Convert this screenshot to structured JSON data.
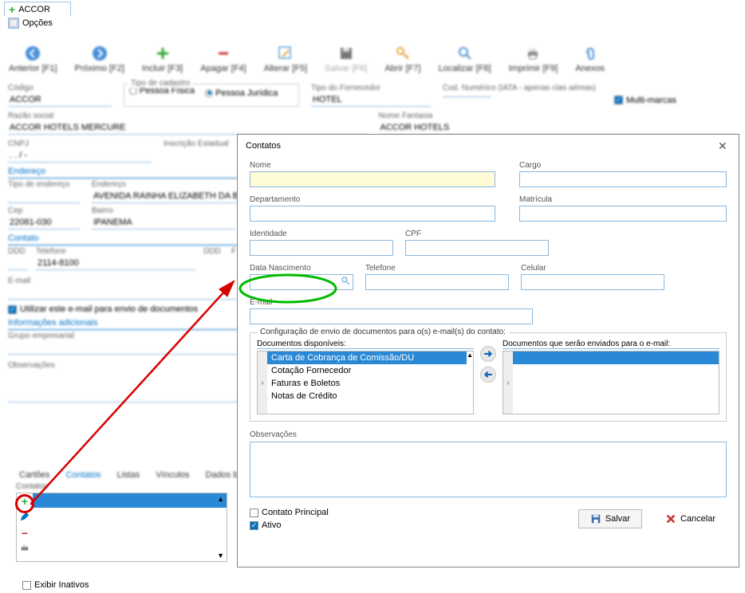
{
  "windowTab": "ACCOR",
  "optionsMenu": "Opções",
  "toolbar": [
    {
      "id": "anterior",
      "label": "Anterior [F1]"
    },
    {
      "id": "proximo",
      "label": "Próximo [F2]"
    },
    {
      "id": "incluir",
      "label": "Incluir [F3]"
    },
    {
      "id": "apagar",
      "label": "Apagar [F4]"
    },
    {
      "id": "alterar",
      "label": "Alterar [F5]"
    },
    {
      "id": "salvar",
      "label": "Salvar [F6]"
    },
    {
      "id": "abrir",
      "label": "Abrir [F7]"
    },
    {
      "id": "localizar",
      "label": "Localizar [F8]"
    },
    {
      "id": "imprimir",
      "label": "Imprimir [F9]"
    },
    {
      "id": "anexos",
      "label": "Anexos"
    }
  ],
  "bg": {
    "codigo": {
      "label": "Código",
      "value": "ACCOR"
    },
    "tipoCadastro": {
      "label": "Tipo de cadastro",
      "opts": [
        "Pessoa Física",
        "Pessoa Jurídica"
      ]
    },
    "tipoFornecedor": {
      "label": "Tipo do Fornecedor",
      "value": "HOTEL"
    },
    "codNumerico": {
      "label": "Cod. Numérico (IATA - apenas cias aéreas)"
    },
    "multiMarcas": "Multi-marcas",
    "razao": {
      "label": "Razão social",
      "value": "ACCOR HOTELS MERCURE"
    },
    "nomeFantasia": {
      "label": "Nome Fantasia",
      "value": "ACCOR HOTELS"
    },
    "cnpj": {
      "label": "CNPJ",
      "value": ". . / -"
    },
    "inscricao": "Inscrição Estadual",
    "enderecoTitle": "Endereço",
    "tipoEndereco": "Tipo de endereço",
    "endereco": {
      "label": "Endereço",
      "value": "AVENIDA RAINHA ELIZABETH DA BÉLG"
    },
    "cep": {
      "label": "Cep",
      "value": "22081-030"
    },
    "bairro": {
      "label": "Bairro",
      "value": "IPANEMA"
    },
    "contatoTitle": "Contato",
    "ddd": "DDD",
    "telefone": {
      "label": "Telefone",
      "value": "2114-8100"
    },
    "dddFax": "DDD",
    "fax": "F",
    "email": "E-mail",
    "utilizarEmail": "Utilizar este e-mail para envio de documentos",
    "infoAdicionaisTitle": "Informações adicionais",
    "grupoEmpresarial": "Grupo empresarial",
    "observacoes": "Observações"
  },
  "tabs": [
    "Cartões",
    "Contatos",
    "Listas",
    "Vínculos",
    "Dados bancários"
  ],
  "activeTab": 1,
  "contactsListTitle": "Contatos",
  "exibirInativos": "Exibir Inativos",
  "dialog": {
    "title": "Contatos",
    "fields": {
      "nome": "Nome",
      "cargo": "Cargo",
      "departamento": "Departamento",
      "matricula": "Matrícula",
      "identidade": "Identidade",
      "cpf": "CPF",
      "dataNascimento": "Data Nascimento",
      "telefone": "Telefone",
      "celular": "Celular",
      "email": "E-mail"
    },
    "docConfig": {
      "legend": "Configuração de envio de documentos para o(s) e-mail(s) do contato:",
      "availableTitle": "Documentos disponíveis:",
      "sendTitle": "Documentos que serão enviados para o e-mail:",
      "available": [
        "Carta de Cobrança de Comissão/DU",
        "Cotação Fornecedor",
        "Faturas e Boletos",
        "Notas de Crédito"
      ]
    },
    "observacoes": "Observações",
    "contatoPrincipal": "Contato Principal",
    "ativo": "Ativo",
    "salvar": "Salvar",
    "cancelar": "Cancelar"
  }
}
